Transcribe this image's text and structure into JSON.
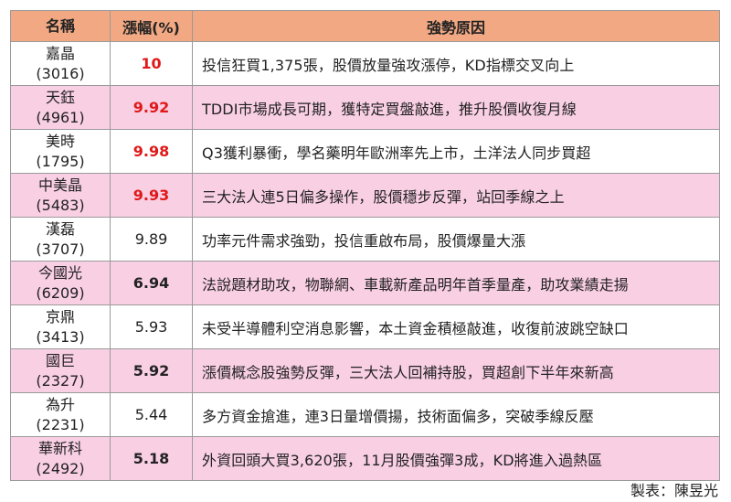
{
  "header": {
    "name": "名稱",
    "pct": "漲幅(%)",
    "reason": "強勢原因"
  },
  "rows": [
    {
      "name": "嘉晶",
      "code": "(3016)",
      "pct": "10",
      "reason": "投信狂買1,375張，股價放量強攻漲停，KD指標交叉向上"
    },
    {
      "name": "天鈺",
      "code": "(4961)",
      "pct": "9.92",
      "reason": "TDDI市場成長可期，獲特定買盤敲進，推升股價收復月線"
    },
    {
      "name": "美時",
      "code": "(1795)",
      "pct": "9.98",
      "reason": "Q3獲利暴衝，學名藥明年歐洲率先上市，土洋法人同步買超"
    },
    {
      "name": "中美晶",
      "code": "(5483)",
      "pct": "9.93",
      "reason": "三大法人連5日偏多操作，股價穩步反彈，站回季線之上"
    },
    {
      "name": "漢磊",
      "code": "(3707)",
      "pct": "9.89",
      "reason": "功率元件需求強勁，投信重啟布局，股價爆量大漲"
    },
    {
      "name": "今國光",
      "code": "(6209)",
      "pct": "6.94",
      "reason": "法說題材助攻，物聯網、車載新產品明年首季量產，助攻業績走揚"
    },
    {
      "name": "京鼎",
      "code": "(3413)",
      "pct": "5.93",
      "reason": "未受半導體利空消息影響，本土資金積極敲進，收復前波跳空缺口"
    },
    {
      "name": "國巨",
      "code": "(2327)",
      "pct": "5.92",
      "reason": "漲價概念股強勢反彈，三大法人回補持股，買超創下半年來新高"
    },
    {
      "name": "為升",
      "code": "(2231)",
      "pct": "5.44",
      "reason": "多方資金搶進，連3日量增價揚，技術面偏多，突破季線反壓"
    },
    {
      "name": "華新科",
      "code": "(2492)",
      "pct": "5.18",
      "reason": "外資回頭大買3,620張，11月股價強彈3成，KD將進入過熱區"
    }
  ],
  "credit": "製表：陳昱光",
  "colors": {
    "header_bg": "#f1a883",
    "stripe_bg": "#f9cfe4",
    "limit_up_red": "#e01818"
  }
}
